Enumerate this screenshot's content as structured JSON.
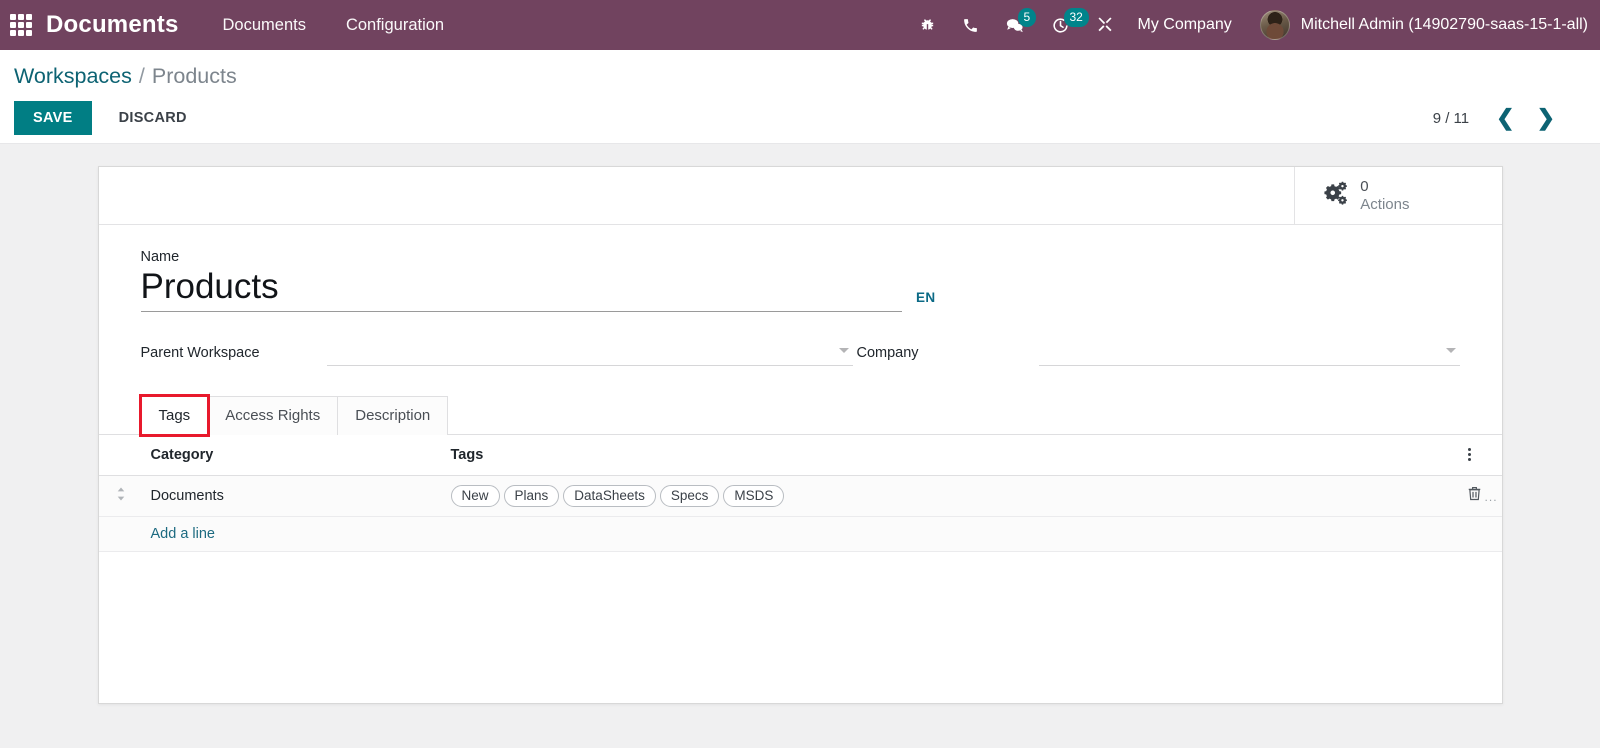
{
  "navbar": {
    "apps_icon": "apps-grid-icon",
    "brand": "Documents",
    "menu": [
      {
        "label": "Documents"
      },
      {
        "label": "Configuration"
      }
    ],
    "sys_icons": [
      {
        "name": "bug-icon",
        "badge": null
      },
      {
        "name": "phone-icon",
        "badge": null
      },
      {
        "name": "messages-icon",
        "badge": "5"
      },
      {
        "name": "activities-clock-icon",
        "badge": "32"
      },
      {
        "name": "developer-tools-icon",
        "badge": null
      }
    ],
    "company": "My Company",
    "user": "Mitchell Admin (14902790-saas-15-1-all)",
    "colors": {
      "navbar_bg": "#71435f",
      "badge_bg": "#00848b"
    }
  },
  "control_panel": {
    "breadcrumb": {
      "root": "Workspaces",
      "separator": "/",
      "current": "Products"
    },
    "save_label": "SAVE",
    "discard_label": "DISCARD",
    "pager": {
      "text": "9 / 11",
      "prev_icon": "chevron-left-icon",
      "next_icon": "chevron-right-icon"
    },
    "colors": {
      "save_bg": "#017e84",
      "link": "#0d6373"
    }
  },
  "form": {
    "stat_button": {
      "icon": "gears-icon",
      "value": "0",
      "label": "Actions"
    },
    "name": {
      "label": "Name",
      "value": "Products",
      "lang_badge": "EN"
    },
    "parent_workspace": {
      "label": "Parent Workspace",
      "value": "",
      "icon": "caret-down-icon"
    },
    "company": {
      "label": "Company",
      "value": "",
      "icon": "caret-down-icon"
    },
    "tabs": [
      {
        "label": "Tags",
        "active": true,
        "highlighted": true
      },
      {
        "label": "Access Rights",
        "active": false,
        "highlighted": false
      },
      {
        "label": "Description",
        "active": false,
        "highlighted": false
      }
    ],
    "tags_table": {
      "columns": [
        "Category",
        "Tags"
      ],
      "optional_columns_icon": "vertical-dots-icon",
      "rows": [
        {
          "handle_icon": "drag-handle-icon",
          "category": "Documents",
          "tags": [
            "New",
            "Plans",
            "DataSheets",
            "Specs",
            "MSDS"
          ],
          "delete_icon": "trash-icon",
          "delete_suffix": "..."
        }
      ],
      "add_line_label": "Add a line"
    }
  },
  "highlight_color": "#e8192c"
}
